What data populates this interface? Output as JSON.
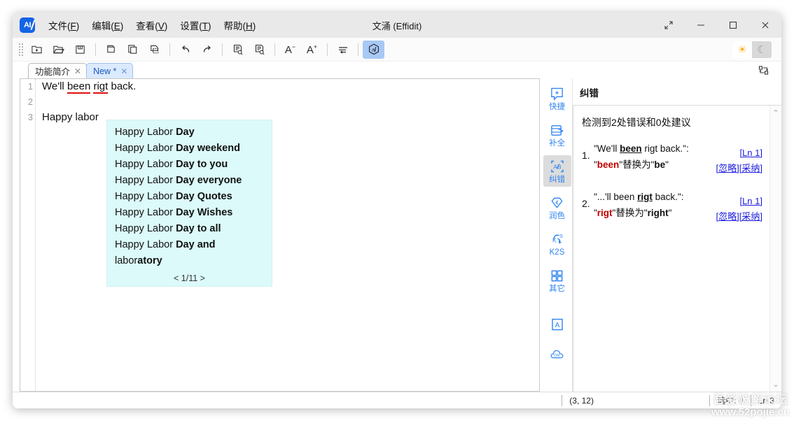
{
  "window": {
    "title": "文涌 (Effidit)",
    "logo_text": "AI",
    "controls": [
      {
        "name": "expand",
        "glyph": "⤢"
      },
      {
        "name": "minimize",
        "glyph": "—"
      },
      {
        "name": "maximize",
        "glyph": "□"
      },
      {
        "name": "close",
        "glyph": "✕"
      }
    ]
  },
  "menu": [
    {
      "label": "文件(F)",
      "text": "文件",
      "accel": "F"
    },
    {
      "label": "编辑(E)",
      "text": "编辑",
      "accel": "E"
    },
    {
      "label": "查看(V)",
      "text": "查看",
      "accel": "V"
    },
    {
      "label": "设置(T)",
      "text": "设置",
      "accel": "T"
    },
    {
      "label": "帮助(H)",
      "text": "帮助",
      "accel": "H"
    }
  ],
  "toolbar": {
    "buttons": [
      {
        "name": "new-file-icon",
        "title": "新建"
      },
      {
        "name": "open-file-icon",
        "title": "打开"
      },
      {
        "name": "save-file-icon",
        "title": "保存"
      },
      {
        "name": "cut-icon",
        "title": "剪切"
      },
      {
        "name": "copy-icon",
        "title": "复制"
      },
      {
        "name": "paste-icon",
        "title": "粘贴"
      },
      {
        "name": "undo-icon",
        "title": "撤销"
      },
      {
        "name": "redo-icon",
        "title": "重做"
      },
      {
        "name": "find-icon",
        "title": "查找"
      },
      {
        "name": "replace-icon",
        "title": "替换"
      },
      {
        "name": "font-decrease-icon",
        "title": "减小字号"
      },
      {
        "name": "font-increase-icon",
        "title": "增大字号"
      },
      {
        "name": "wrap-icon",
        "title": "自动换行"
      },
      {
        "name": "ai-icon",
        "title": "AI",
        "active": true
      }
    ],
    "font_decrease_label": "A",
    "font_increase_label": "A",
    "ai_label": "AI",
    "theme": {
      "light_glyph": "☀",
      "dark_glyph": "☾",
      "active": "light"
    }
  },
  "tabs": [
    {
      "label": "功能简介",
      "close": "✕",
      "active": false
    },
    {
      "label": "New *",
      "close": "✕",
      "active": true
    }
  ],
  "editor": {
    "line_numbers": [
      "1",
      "2",
      "3"
    ],
    "lines": [
      {
        "segments": [
          {
            "text": "We'll ",
            "error": false
          },
          {
            "text": "been",
            "error": true
          },
          {
            "text": " ",
            "error": false
          },
          {
            "text": "rigt",
            "error": true
          },
          {
            "text": " back.",
            "error": false
          }
        ]
      },
      {
        "segments": []
      },
      {
        "segments": [
          {
            "text": "Happy labor",
            "error": false
          }
        ]
      }
    ],
    "autocomplete": {
      "prefix": "Happy Labor ",
      "items": [
        {
          "plain": "Happy Labor ",
          "bold": "Day"
        },
        {
          "plain": "Happy Labor ",
          "bold": "Day weekend"
        },
        {
          "plain": "Happy Labor ",
          "bold": "Day to you"
        },
        {
          "plain": "Happy Labor ",
          "bold": "Day everyone"
        },
        {
          "plain": "Happy Labor ",
          "bold": "Day Quotes"
        },
        {
          "plain": "Happy Labor ",
          "bold": "Day Wishes"
        },
        {
          "plain": "Happy Labor ",
          "bold": "Day to all"
        },
        {
          "plain": "Happy Labor ",
          "bold": "Day and"
        },
        {
          "plain": "labor",
          "bold": "atory"
        }
      ],
      "pager": "< 1/11 >"
    }
  },
  "rail": [
    {
      "label": "快捷",
      "icon": "quick-bolt-icon",
      "active": false
    },
    {
      "label": "补全",
      "icon": "autocomplete-icon",
      "active": false
    },
    {
      "label": "纠错",
      "icon": "proofread-abc-icon",
      "active": true
    },
    {
      "label": "润色",
      "icon": "polish-gem-icon",
      "active": false
    },
    {
      "label": "K2S",
      "icon": "k2s-icon",
      "active": false
    },
    {
      "label": "其它",
      "icon": "grid-other-icon",
      "active": false
    },
    {
      "label": "",
      "icon": "letter-a-icon",
      "active": false
    },
    {
      "label": "",
      "icon": "cloud-on-icon",
      "active": false
    }
  ],
  "rail_icon_text": {
    "proofread": "AB",
    "k2s_k": "K",
    "k2s_s": "S",
    "letter_a": "A",
    "cloud_on": "ON"
  },
  "panel": {
    "title": "纠错",
    "summary": "检测到2处错误和0处建议",
    "issues": [
      {
        "num": "1.",
        "quote_pre": "\"We'll ",
        "quote_bold": "been",
        "quote_post": " rigt back.\":",
        "fix_quote_open": "\"",
        "fix_bad": "been",
        "fix_quote_close": "\"",
        "fix_mid": "替换为",
        "fix_to_open": "\"",
        "fix_to": "be",
        "fix_to_close": "\"",
        "line_link": "[Ln 1]",
        "ignore_link": "[忽略]",
        "accept_link": "[采纳]"
      },
      {
        "num": "2.",
        "quote_pre": "\"...'ll been ",
        "quote_bold": "rigt",
        "quote_post": " back.\":",
        "fix_quote_open": "\"",
        "fix_bad": "rigt",
        "fix_quote_close": "\"",
        "fix_mid": "替换为",
        "fix_to_open": "\"",
        "fix_to": "right",
        "fix_to_close": "\"",
        "line_link": "[Ln 1]",
        "ignore_link": "[忽略]",
        "accept_link": "[采纳]"
      }
    ],
    "scroll_up": "⌃",
    "scroll_down": "⌄"
  },
  "statusbar": {
    "cursor": "(3, 12)",
    "selection_label": "选中:",
    "selection_count": "0",
    "extra": "Ln 3"
  },
  "watermark": {
    "cn": "吾爱破解论坛",
    "url": "www.52pojie.cn"
  },
  "colors": {
    "accent": "#2f84f0",
    "error": "#c00000",
    "link": "#1a1ae0",
    "popup_bg": "#dcfafa",
    "tab_active": "#dbeaff"
  }
}
